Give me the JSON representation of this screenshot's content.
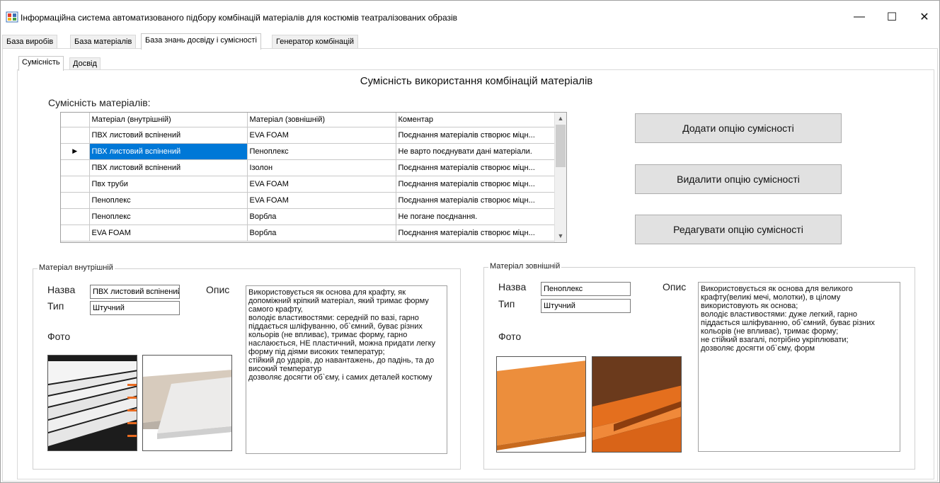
{
  "window": {
    "title": "Інформаційна система автоматизованого підбору комбінацій матеріалів для костюмів театралізованих образів",
    "minimize": "—",
    "maximize": "☐",
    "close": "✕"
  },
  "main_tabs": [
    {
      "label": "База виробів"
    },
    {
      "label": "База матеріалів"
    },
    {
      "label": "База знань досвіду і сумісності"
    },
    {
      "label": "Генератор комбінацій"
    }
  ],
  "active_main_tab": "База знань досвіду і сумісності",
  "sub_tabs": [
    {
      "label": "Сумісність"
    },
    {
      "label": "Досвід"
    }
  ],
  "heading": "Сумісність використання комбінацій матеріалів",
  "grid_caption": "Сумісність матеріалів:",
  "grid": {
    "columns": [
      "Матеріал (внутрішній)",
      "Матеріал (зовнішній)",
      "Коментар"
    ],
    "rows": [
      {
        "inner": "ПВХ листовий вспінений",
        "outer": "EVA FOAM",
        "comment": "Поєднання матеріалів створює міцн...",
        "marker": ""
      },
      {
        "inner": "ПВХ листовий вспінений",
        "outer": "Пеноплекс",
        "comment": "Не варто поєднувати дані матеріали.",
        "marker": "▶"
      },
      {
        "inner": "ПВХ листовий вспінений",
        "outer": "Ізолон",
        "comment": "Поєднання матеріалів створює міцн...",
        "marker": ""
      },
      {
        "inner": "Пвх труби",
        "outer": "EVA FOAM",
        "comment": "Поєднання матеріалів створює міцн...",
        "marker": ""
      },
      {
        "inner": "Пеноплекс",
        "outer": "EVA FOAM",
        "comment": "Поєднання матеріалів створює міцн...",
        "marker": ""
      },
      {
        "inner": "Пеноплекс",
        "outer": "Ворбла",
        "comment": "Не погане поєднання.",
        "marker": ""
      },
      {
        "inner": "EVA FOAM",
        "outer": "Ворбла",
        "comment": "Поєднання матеріалів створює міцн...",
        "marker": ""
      }
    ],
    "selected_row": 1
  },
  "buttons": {
    "add": "Додати опцію сумісності",
    "delete": "Видалити опцію сумісності",
    "edit": "Редагувати опцію сумісності"
  },
  "inner_material": {
    "group_title": "Матеріал внутрішній",
    "name_label": "Назва",
    "name_value": "ПВХ листовий вспінений",
    "type_label": "Тип",
    "type_value": "Штучний",
    "desc_label": "Опис",
    "photo_label": "Фото",
    "description": "Використовується як основа для крафту, як допоміжний кріпкий матеріал, який тримає форму самого крафту,\nволодіє властивостями: середній по вазі, гарно піддається шліфуванню, об`ємний, буває різних кольорів (не впливає), тримає форму, гарно наслаюється, НЕ пластичний, можна придати легку форму під діями високих температур;\nстійкий до ударів, до навантажень, до падінь, та до високий температур\nдозволяє досягти об`єму, і самих деталей костюму"
  },
  "outer_material": {
    "group_title": "Матеріал зовнішній",
    "name_label": "Назва",
    "name_value": "Пеноплекс",
    "type_label": "Тип",
    "type_value": "Штучний",
    "desc_label": "Опис",
    "photo_label": "Фото",
    "description": "Використовується як основа для великого крафту(великі мечі, молотки), в цілому використовують як основа;\nволодіє властивостями: дуже легкий, гарно піддається шліфуванню, об`ємний, буває різних кольорів (не впливає), тримає форму;\nне стійкий взагалі, потрібно укріплювати;\nдозволяє досягти об`єму, форм"
  },
  "colors": {
    "selection": "#0078d7",
    "button_face": "#e1e1e1",
    "orange_foam": "#e98a34"
  }
}
